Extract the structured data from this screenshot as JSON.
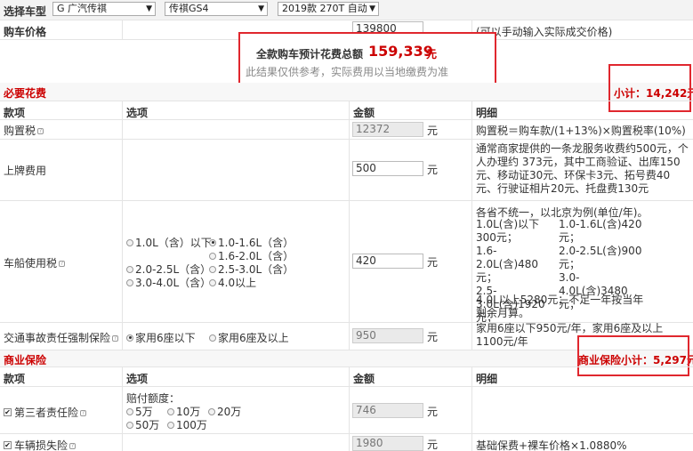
{
  "selector": {
    "label": "选择车型",
    "brand": "G 广汽传祺",
    "series": "传祺GS4",
    "model": "2019款 270T 自动"
  },
  "price_row": {
    "label": "购车价格",
    "value": "139800",
    "hint": "(可以手动输入实际成交价格)"
  },
  "total": {
    "label": "全款购车预计花费总额",
    "value": "159,339",
    "unit": "元",
    "note": "此结果仅供参考，实际费用以当地缴费为准"
  },
  "required": {
    "title": "必要花费",
    "subtotal": "小计：14,242元",
    "headers": [
      "款项",
      "选项",
      "金额",
      "明细"
    ],
    "purchase_tax": {
      "label": "购置税",
      "value": "12372",
      "unit": "元",
      "detail": "购置税＝购车款/(1+13%)×购置税率(10%)"
    },
    "plate_fee": {
      "label": "上牌费用",
      "value": "500",
      "unit": "元",
      "detail": "通常商家提供的一条龙服务收费约500元，个人办理约 373元，其中工商验证、出库150元、移动证30元、环保卡3元、拓号费40元、行驶证相片20元、托盘费130元"
    },
    "vehicle_tax": {
      "label": "车船使用税",
      "value": "420",
      "unit": "元",
      "options": [
        {
          "text": "1.0L（含）以下",
          "checked": false
        },
        {
          "text": "1.0-1.6L（含）",
          "checked": true
        },
        {
          "text": "1.6-2.0L（含）",
          "checked": false
        },
        {
          "text": "2.0-2.5L（含）",
          "checked": false
        },
        {
          "text": "2.5-3.0L（含）",
          "checked": false
        },
        {
          "text": "3.0-4.0L（含）",
          "checked": false
        },
        {
          "text": "4.0以上",
          "checked": false
        }
      ],
      "detail_intro": "各省不统一，以北京为例(单位/年)。",
      "detail_left": [
        "1.0L(含)以下300元；",
        "1.6-2.0L(含)480元；",
        "2.5-3.0L(含)1920元；"
      ],
      "detail_right": [
        "1.0-1.6L(含)420元；",
        "2.0-2.5L(含)900元；",
        "3.0-4.0L(含)3480元；"
      ],
      "detail_tail": "4.0L以上5280元；不足一年按当年剩余月算。"
    },
    "compulsory_insurance": {
      "label": "交通事故责任强制保险",
      "options": [
        {
          "text": "家用6座以下",
          "checked": true
        },
        {
          "text": "家用6座及以上",
          "checked": false
        }
      ],
      "value": "950",
      "unit": "元",
      "detail": "家用6座以下950元/年，家用6座及以上1100元/年"
    }
  },
  "commercial": {
    "title": "商业保险",
    "subtotal": "商业保险小计：5,297元",
    "headers": [
      "款项",
      "选项",
      "金额",
      "明细"
    ],
    "third_party": {
      "label": "第三者责任险",
      "checked": true,
      "options_title": "赔付额度：",
      "options": [
        {
          "text": "5万",
          "checked": false
        },
        {
          "text": "10万",
          "checked": false
        },
        {
          "text": "20万",
          "checked": false
        },
        {
          "text": "50万",
          "checked": false
        },
        {
          "text": "100万",
          "checked": false
        }
      ],
      "value": "746",
      "unit": "元"
    },
    "vehicle_loss": {
      "label": "车辆损失险",
      "checked": true,
      "value": "1980",
      "unit": "元",
      "detail": "基础保费+裸车价格×1.0880%"
    }
  }
}
